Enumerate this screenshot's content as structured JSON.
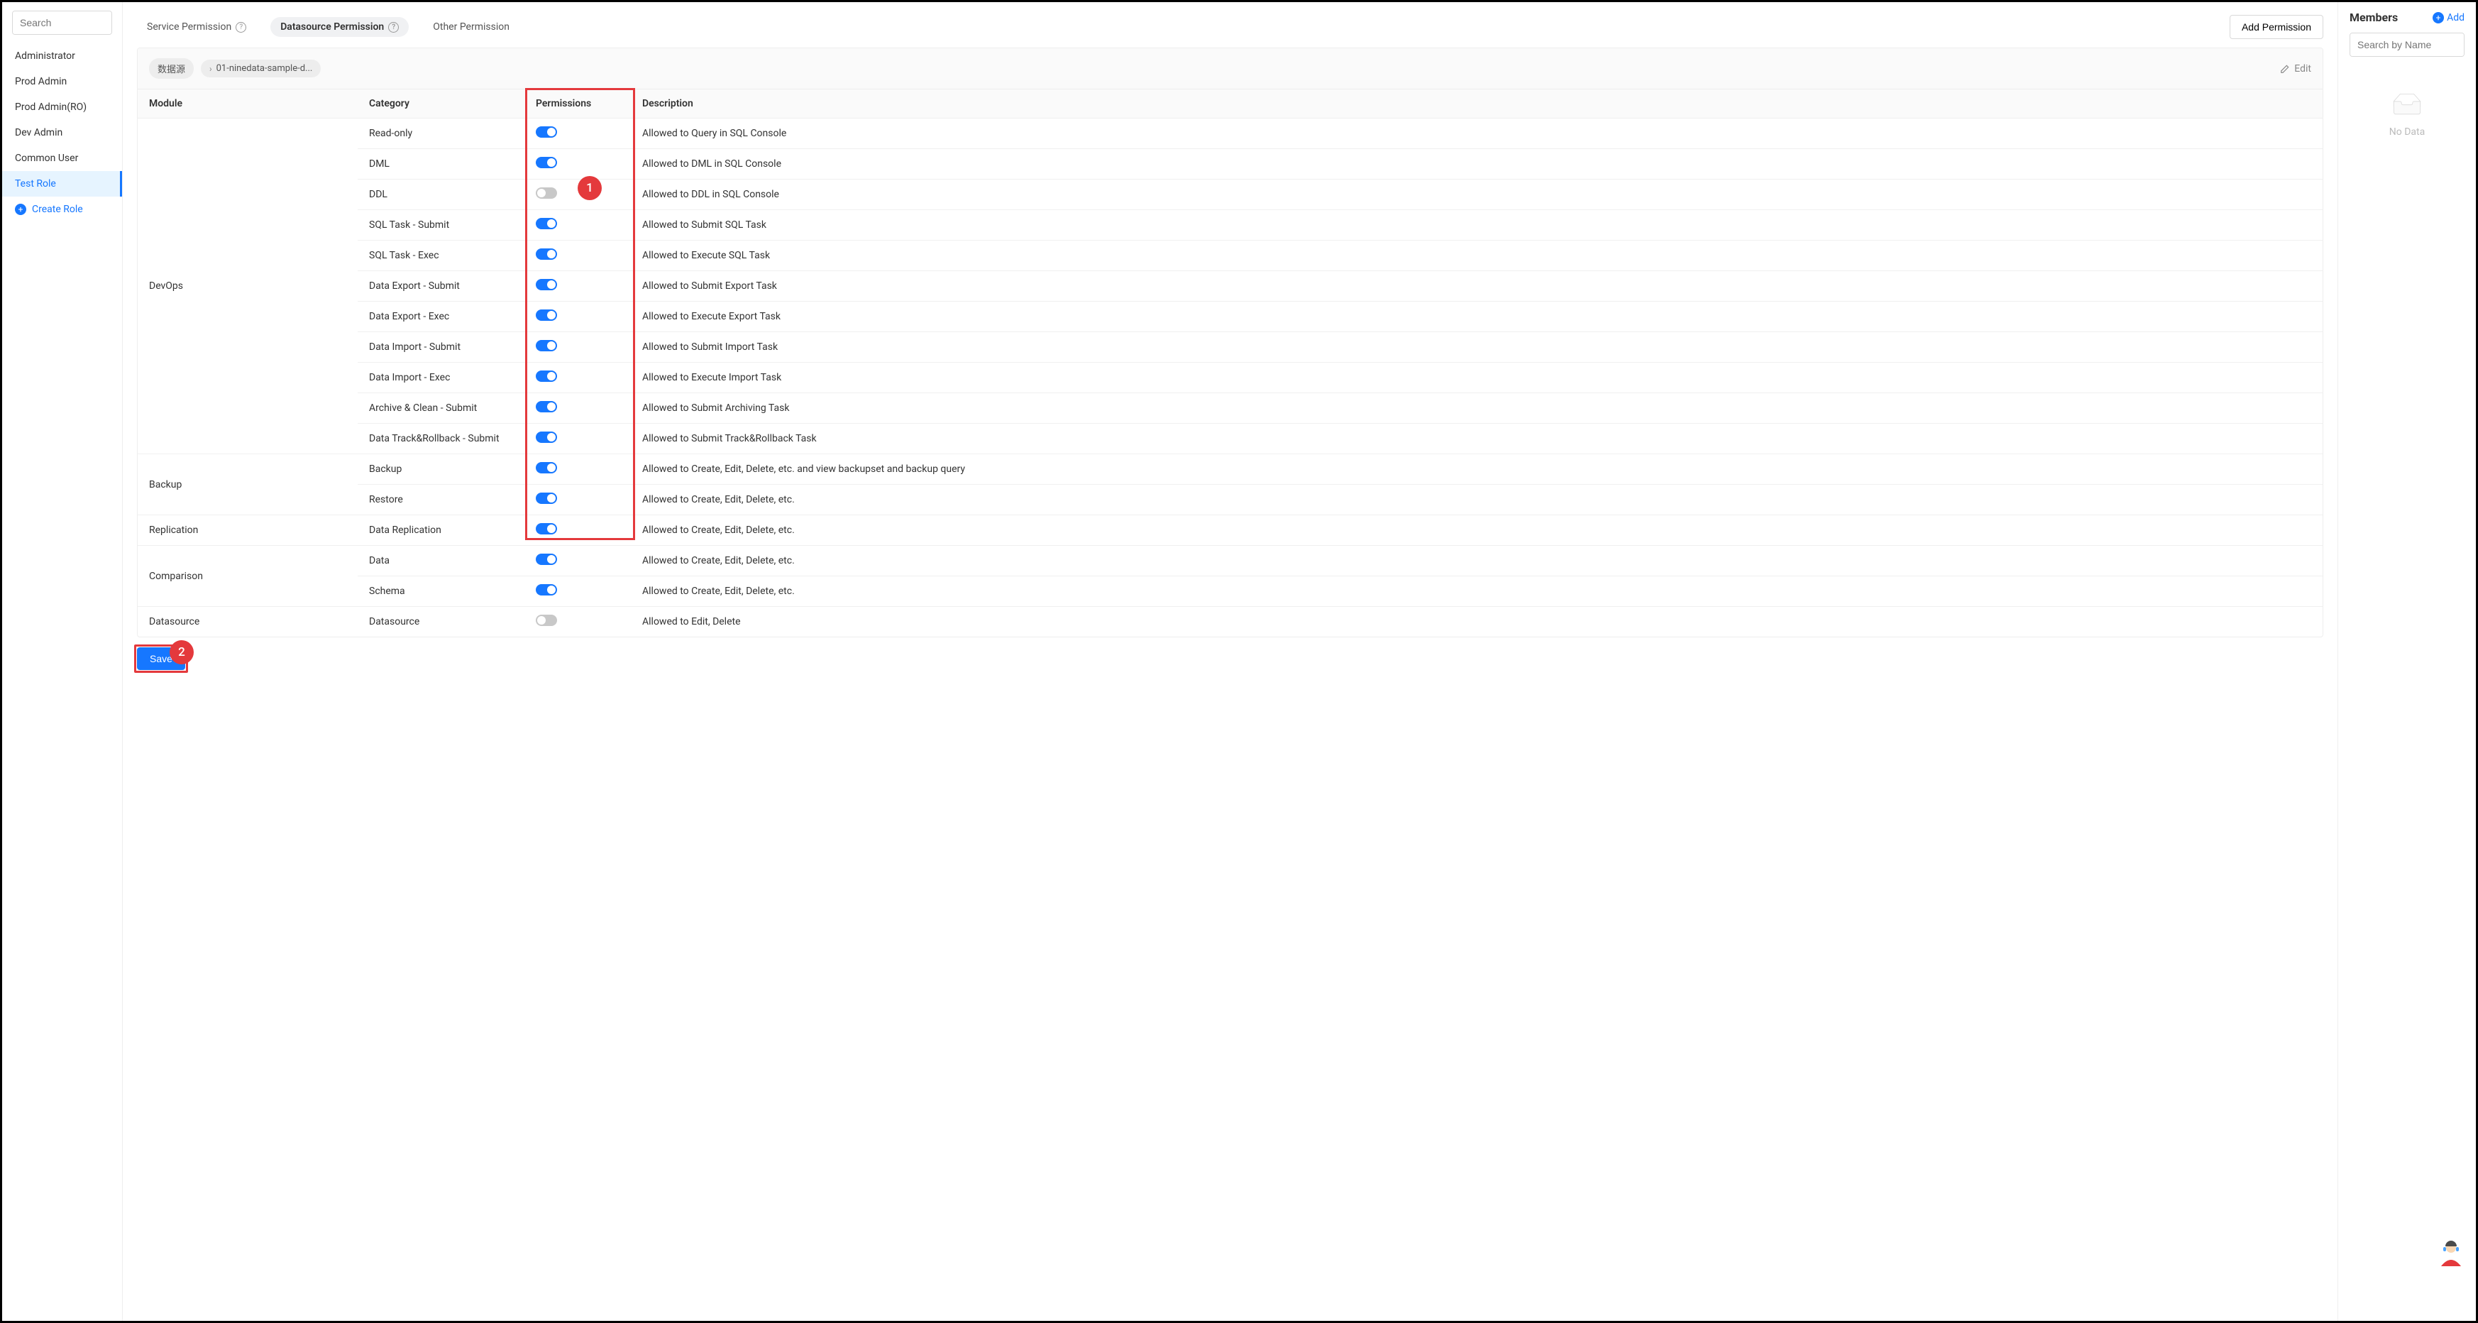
{
  "sidebar": {
    "search_placeholder": "Search",
    "roles": [
      "Administrator",
      "Prod Admin",
      "Prod Admin(RO)",
      "Dev Admin",
      "Common User",
      "Test Role"
    ],
    "selected_index": 5,
    "create_role_label": "Create Role"
  },
  "tabs": {
    "items": [
      {
        "label": "Service Permission",
        "has_help": true,
        "active": false
      },
      {
        "label": "Datasource Permission",
        "has_help": true,
        "active": true
      },
      {
        "label": "Other Permission",
        "has_help": false,
        "active": false
      }
    ],
    "add_permission_label": "Add Permission"
  },
  "card_head": {
    "chip1": "数据源",
    "chip2": "01-ninedata-sample-d...",
    "edit_label": "Edit"
  },
  "table": {
    "headers": {
      "module": "Module",
      "category": "Category",
      "permissions": "Permissions",
      "description": "Description"
    },
    "modules": [
      {
        "name": "DevOps",
        "rows": [
          {
            "category": "Read-only",
            "on": true,
            "desc": "Allowed to Query in SQL Console"
          },
          {
            "category": "DML",
            "on": true,
            "desc": "Allowed to DML in SQL Console"
          },
          {
            "category": "DDL",
            "on": false,
            "desc": "Allowed to DDL in SQL Console"
          },
          {
            "category": "SQL Task - Submit",
            "on": true,
            "desc": "Allowed to Submit SQL Task"
          },
          {
            "category": "SQL Task - Exec",
            "on": true,
            "desc": "Allowed to Execute SQL Task"
          },
          {
            "category": "Data Export - Submit",
            "on": true,
            "desc": "Allowed to Submit Export Task"
          },
          {
            "category": "Data Export - Exec",
            "on": true,
            "desc": "Allowed to Execute Export Task"
          },
          {
            "category": "Data Import - Submit",
            "on": true,
            "desc": "Allowed to Submit Import Task"
          },
          {
            "category": "Data Import - Exec",
            "on": true,
            "desc": "Allowed to Execute Import Task"
          },
          {
            "category": "Archive & Clean - Submit",
            "on": true,
            "desc": "Allowed to Submit Archiving Task"
          },
          {
            "category": "Data Track&Rollback - Submit",
            "on": true,
            "desc": "Allowed to Submit Track&Rollback Task"
          }
        ]
      },
      {
        "name": "Backup",
        "rows": [
          {
            "category": "Backup",
            "on": true,
            "desc": "Allowed to Create, Edit, Delete, etc. and view backupset and backup query"
          },
          {
            "category": "Restore",
            "on": true,
            "desc": "Allowed to Create, Edit, Delete, etc."
          }
        ]
      },
      {
        "name": "Replication",
        "rows": [
          {
            "category": "Data Replication",
            "on": true,
            "desc": "Allowed to Create, Edit, Delete, etc."
          }
        ]
      },
      {
        "name": "Comparison",
        "rows": [
          {
            "category": "Data",
            "on": true,
            "desc": "Allowed to Create, Edit, Delete, etc."
          },
          {
            "category": "Schema",
            "on": true,
            "desc": "Allowed to Create, Edit, Delete, etc."
          }
        ]
      },
      {
        "name": "Datasource",
        "rows": [
          {
            "category": "Datasource",
            "on": false,
            "desc": "Allowed to Edit, Delete"
          }
        ]
      }
    ]
  },
  "save_label": "Save",
  "members": {
    "title": "Members",
    "add_label": "Add",
    "search_placeholder": "Search by Name",
    "nodata_label": "No Data"
  },
  "annotations": {
    "num1": "1",
    "num2": "2"
  }
}
